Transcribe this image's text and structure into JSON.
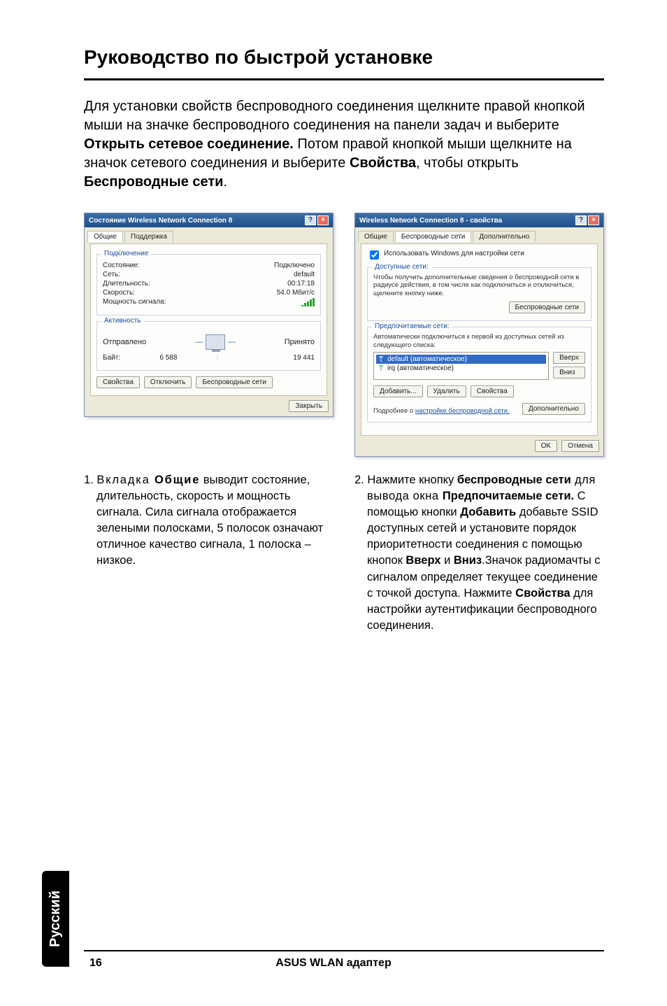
{
  "page": {
    "title": "Руководство по быстрой установке",
    "intro_parts": [
      "Для установки свойств беспроводного соединения щелкните правой кнопкой мыши на значке беспроводного соединения на панели задач и выберите ",
      "Открыть сетевое соединение.",
      " Потом правой кнопкой мыши щелкните на значок сетевого соединения и выберите ",
      "Свойства",
      ", чтобы открыть ",
      "Беспроводные сети",
      "."
    ]
  },
  "win1": {
    "title": "Состояние Wireless Network Connection 8",
    "tabs": [
      "Общие",
      "Поддержка"
    ],
    "group1_title": "Подключение",
    "rows": {
      "state_label": "Состояние:",
      "state_value": "Подключено",
      "network_label": "Сеть:",
      "network_value": "default",
      "duration_label": "Длительность:",
      "duration_value": "00:17:18",
      "speed_label": "Скорость:",
      "speed_value": "54.0 Мбит/с",
      "strength_label": "Мощность сигнала:"
    },
    "group2_title": "Активность",
    "sent_label": "Отправлено",
    "recv_label": "Принято",
    "bytes_label": "Байт:",
    "bytes_sent": "6 588",
    "bytes_recv": "19 441",
    "btn_props": "Свойства",
    "btn_disable": "Отключить",
    "btn_wireless": "Беспроводные сети",
    "btn_close": "Закрыть"
  },
  "win2": {
    "title": "Wireless Network Connection 8 - свойства",
    "tabs": [
      "Общие",
      "Беспроводные сети",
      "Дополнительно"
    ],
    "chk_windows": "Использовать Windows для настройки сети",
    "group_avail_title": "Доступные сети:",
    "avail_text": "Чтобы получить дополнительные сведения о беспроводной сети в радиусе действия, в том числе как подключиться и отключиться, щелкните кнопку ниже.",
    "btn_wnets": "Беспроводные сети",
    "group_pref_title": "Предпочитаемые сети:",
    "pref_text": "Автоматически подключиться к первой из доступных сетей из следующего списка:",
    "nets": [
      "default (автоматическое)",
      "irq (автоматическое)"
    ],
    "btn_up": "Вверх",
    "btn_down": "Вниз",
    "btn_add": "Добавить...",
    "btn_remove": "Удалить",
    "btn_props": "Свойства",
    "more_label": "Подробнее о ",
    "more_link": "настройке беспроводной сети.",
    "btn_more": "Дополнительно",
    "ok": "OK",
    "cancel": "Отмена"
  },
  "captions": {
    "c1_num": "1. ",
    "c1_lead": "Вкладка ",
    "c1_bold": "Общие",
    "c1_rest1": " выводит состояние, длительность, скорость и мощность сигнала. Сила сигнала отображается зелеными полосками, 5 полосок означают отличное качество сигнала, 1 полоска – низкое.",
    "c2_num": "2. ",
    "c2_a": "Нажмите кнопку ",
    "c2_b1": "беспроводные сети",
    "c2_c": " для вывода окна ",
    "c2_b2": "Предпочитаемые сети.",
    "c2_d": " С помощью кнопки ",
    "c2_b3": "Добавить",
    "c2_e": " добавьте SSID доступных сетей и установите порядок приоритетности соединения с помощью кнопок ",
    "c2_b4": "Вверх",
    "c2_f": " и ",
    "c2_b5": "Вниз",
    "c2_g": ".Значок радиомачты с сигналом определяет текущее соединение с точкой доступа. Нажмите ",
    "c2_b6": "Свойства",
    "c2_h": " для настройки аутентификации беспроводного соединения."
  },
  "footer": {
    "lang": "Русский",
    "page_no": "16",
    "center": "ASUS WLAN адаптер"
  }
}
